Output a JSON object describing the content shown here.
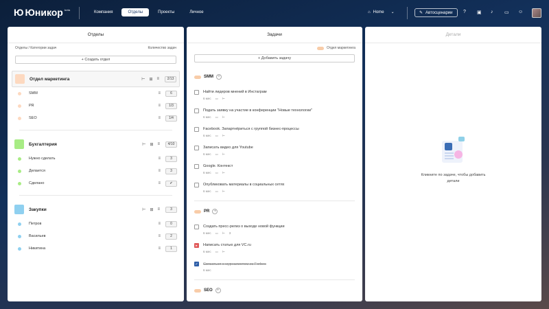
{
  "topbar": {
    "logo": "Юникор",
    "beta": "beta",
    "tabs": [
      "Компания",
      "Отделы",
      "Проекты",
      "Личное"
    ],
    "active_tab": "Отделы",
    "home_label": "Home",
    "autoscenarios_label": "Автосценарии"
  },
  "departments_panel": {
    "title": "Отделы",
    "sub_left": "Отделы / Категории задач",
    "sub_right": "Количество задач",
    "create_button": "+ Создать отдел",
    "departments": [
      {
        "name": "Отдел маркетинга",
        "color": "#fdd9c0",
        "count": "2/13",
        "categories": [
          {
            "name": "SMM",
            "count": "6",
            "color": "#fdd9c0"
          },
          {
            "name": "PR",
            "count": "1/3",
            "color": "#fdd9c0"
          },
          {
            "name": "SEO",
            "count": "1/4",
            "color": "#fdd9c0"
          }
        ]
      },
      {
        "name": "Бухгалтерия",
        "color": "#a8ec85",
        "count": "4/10",
        "categories": [
          {
            "name": "Нужно сделать",
            "count": "3",
            "color": "#a8ec85"
          },
          {
            "name": "Делается",
            "count": "3",
            "color": "#a8ec85"
          },
          {
            "name": "Сделано",
            "count": "✔",
            "color": "#a8ec85"
          }
        ]
      },
      {
        "name": "Закупки",
        "color": "#8fd0f0",
        "count": "3",
        "categories": [
          {
            "name": "Петров",
            "count": "0",
            "color": "#8fd0f0"
          },
          {
            "name": "Васильев",
            "count": "2",
            "color": "#8fd0f0"
          },
          {
            "name": "Никитина",
            "count": "1",
            "color": "#8fd0f0"
          }
        ]
      }
    ]
  },
  "tasks_panel": {
    "title": "Задачи",
    "department_tag": "Отдел маркетинга",
    "add_button": "+ Добавить задачу",
    "groups": [
      {
        "name": "SMM",
        "tasks": [
          {
            "title": "Найти лидеров мнений в Инстаграм",
            "age": "6 мес",
            "sub": ""
          },
          {
            "title": "Подать заявку на участие в конференции \"Новые технологии\"",
            "age": "6 мес",
            "sub": ""
          },
          {
            "title": "Facebook. Запартнёриться с группой бизнес-процессы",
            "age": "6 мес",
            "sub": ""
          },
          {
            "title": "Записать видео для Youtube",
            "age": "6 мес",
            "sub": ""
          },
          {
            "title": "Google. Контекст",
            "age": "6 мес",
            "sub": ""
          },
          {
            "title": "Опубликовать материалы в социальных сетях",
            "age": "6 мес",
            "sub": ""
          }
        ]
      },
      {
        "name": "PR",
        "tasks": [
          {
            "title": "Создать пресс-релиз о выходе новой функции",
            "age": "6 мес",
            "sub": "3"
          },
          {
            "title": "Написать статью для VC.ru",
            "age": "6 мес",
            "sub": ""
          },
          {
            "title": "Связаться с журналистом из Forbes",
            "age": "6 мес",
            "sub": ""
          }
        ]
      },
      {
        "name": "SEO",
        "tasks": []
      }
    ]
  },
  "details_panel": {
    "title": "Детали",
    "empty_line1": "Кликните по задаче, чтобы добавить",
    "empty_line2": "детали"
  }
}
